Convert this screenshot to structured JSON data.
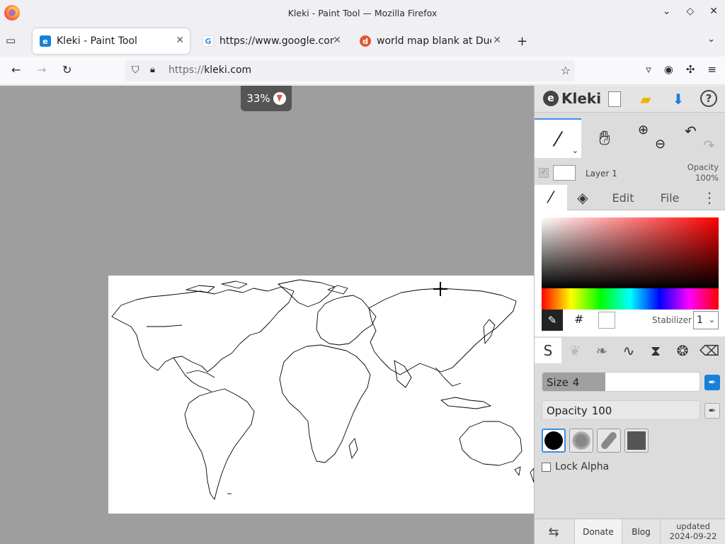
{
  "window": {
    "title": "Kleki - Paint Tool — Mozilla Firefox",
    "controls": {
      "minimize": "⌄",
      "maximize": "◇",
      "close": "✕"
    }
  },
  "tabs": [
    {
      "label": "Kleki - Paint Tool",
      "favicon": "kleki-icon",
      "active": true
    },
    {
      "label": "https://www.google.com",
      "favicon": "google-icon",
      "active": false
    },
    {
      "label": "world map blank at Duck",
      "favicon": "duckduckgo-icon",
      "active": false
    }
  ],
  "tab_strip": {
    "new_tab": "+",
    "list_all": "⌄"
  },
  "navbar": {
    "url_protocol": "https://",
    "url_host": "kleki.com",
    "back": "←",
    "forward": "→",
    "reload": "↻"
  },
  "canvas": {
    "zoom_label": "33%"
  },
  "panel": {
    "app_name": "Kleki",
    "layer": {
      "name": "Layer 1",
      "opacity_label": "Opacity",
      "opacity_value": "100%"
    },
    "tabs": {
      "edit": "Edit",
      "file": "File"
    },
    "stabilizer": {
      "label": "Stabilizer",
      "value": "1"
    },
    "size": {
      "label": "Size",
      "value": "4"
    },
    "opacity": {
      "label": "Opacity",
      "value": "100"
    },
    "lock_alpha": "Lock Alpha",
    "footer": {
      "donate": "Donate",
      "blog": "Blog",
      "updated_label": "updated",
      "updated_date": "2024-09-22"
    },
    "colors": {
      "accent": "#3a8ee6",
      "primary_color": "#ffffff",
      "hue_color": "#ff0000"
    },
    "levels": {
      "size_fill_fraction": 0.4
    }
  }
}
